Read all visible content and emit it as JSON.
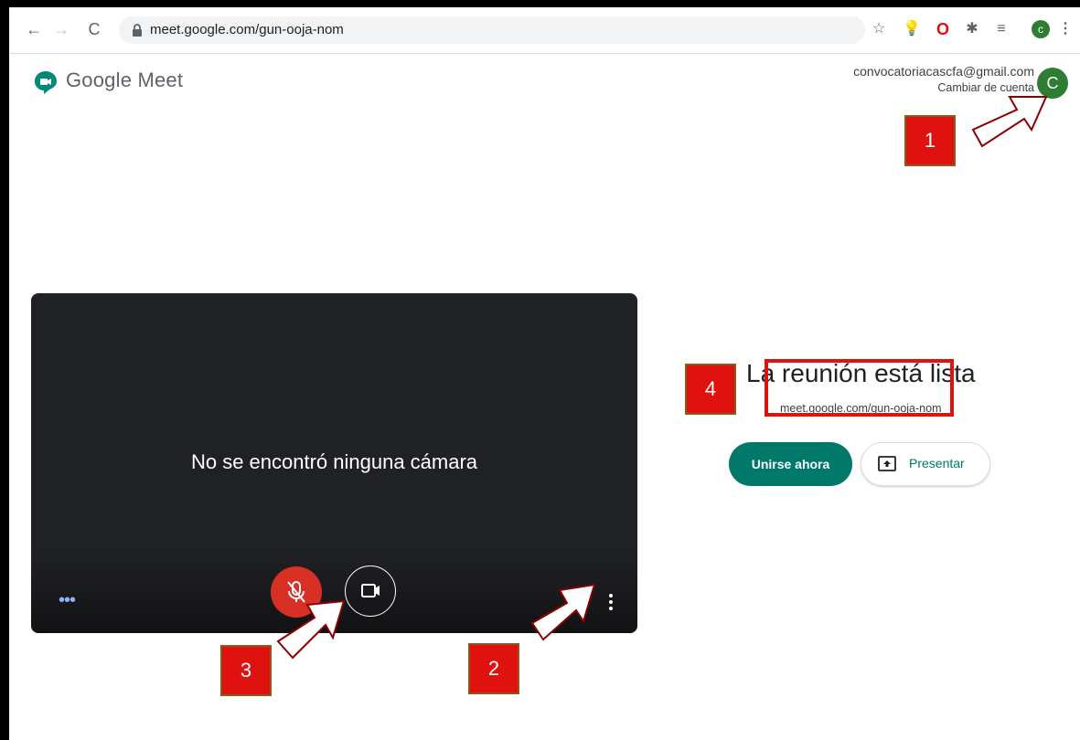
{
  "browser": {
    "url": "meet.google.com/gun-ooja-nom",
    "profile_initial": "c"
  },
  "header": {
    "brand": "Google Meet",
    "account_email": "convocatoriacascfa@gmail.com",
    "switch_account": "Cambiar de cuenta",
    "avatar_initial": "C"
  },
  "preview": {
    "no_camera_text": "No se encontró ninguna cámara"
  },
  "join_panel": {
    "title": "La reunión está lista",
    "meeting_link": "meet.google.com/gun-ooja-nom",
    "join_label": "Unirse ahora",
    "present_label": "Presentar"
  },
  "annotations": {
    "badge_1": "1",
    "badge_2": "2",
    "badge_3": "3",
    "badge_4": "4"
  },
  "colors": {
    "accent": "#00796b",
    "mic_off": "#d93025",
    "annotation": "#e0120f"
  }
}
